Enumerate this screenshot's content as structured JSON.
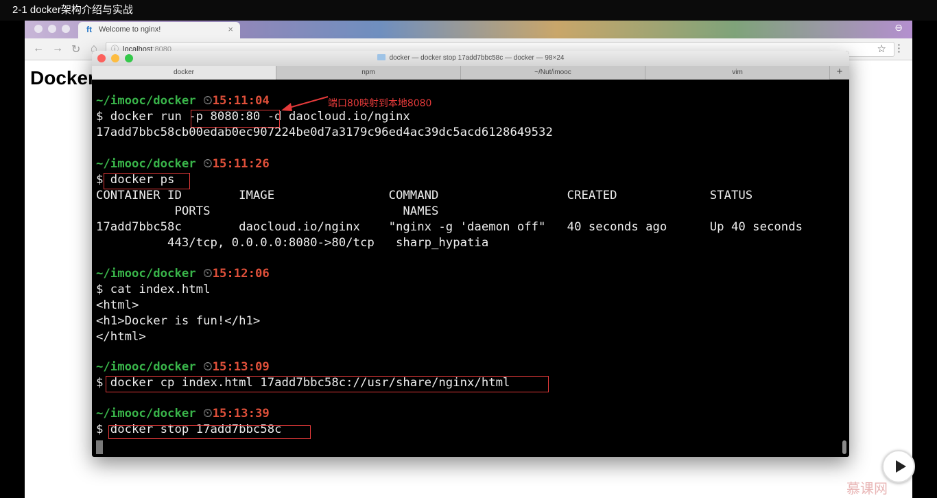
{
  "player": {
    "title": "2-1 docker架构介绍与实战"
  },
  "browser": {
    "tab_title": "Welcome to nginx!",
    "tab_favicon": "ft",
    "address_host": "localhost",
    "address_port": ":8080",
    "page_heading": "Docker"
  },
  "terminal": {
    "window_title": "docker — docker stop 17add7bbc58c — docker — 98×24",
    "tabs": [
      "docker",
      "npm",
      "~/Nut/imooc",
      "vim"
    ],
    "add_tab": "+",
    "lines": [
      {
        "path": "~/imooc/docker",
        "clock": "⏲",
        "time": "15:11:04"
      },
      {
        "text": "$ docker run -p 8080:80 -d daocloud.io/nginx"
      },
      {
        "text": "17add7bbc58cb00edab0ec907224be0d7a3179c96ed4ac39dc5acd6128649532"
      },
      {
        "path": "~/imooc/docker",
        "clock": "⏲",
        "time": "15:11:26"
      },
      {
        "text": "$ docker ps"
      },
      {
        "text": "CONTAINER ID        IMAGE                COMMAND                  CREATED             STATUS"
      },
      {
        "text": "           PORTS                           NAMES"
      },
      {
        "text": "17add7bbc58c        daocloud.io/nginx    \"nginx -g 'daemon off\"   40 seconds ago      Up 40 seconds"
      },
      {
        "text": "          443/tcp, 0.0.0.0:8080->80/tcp   sharp_hypatia"
      },
      {
        "path": "~/imooc/docker",
        "clock": "⏲",
        "time": "15:12:06"
      },
      {
        "text": "$ cat index.html"
      },
      {
        "text": "<html>"
      },
      {
        "text": "<h1>Docker is fun!</h1>"
      },
      {
        "text": "</html>"
      },
      {
        "path": "~/imooc/docker",
        "clock": "⏲",
        "time": "15:13:09"
      },
      {
        "text": "$ docker cp index.html 17add7bbc58c://usr/share/nginx/html"
      },
      {
        "path": "~/imooc/docker",
        "clock": "⏲",
        "time": "15:13:39"
      },
      {
        "text": "$ docker stop 17add7bbc58c"
      }
    ]
  },
  "annotation": {
    "text": "端口80映射到本地8080"
  },
  "watermark": "慕课网",
  "colors": {
    "prompt_path": "#39b54a",
    "prompt_time": "#e0503a",
    "highlight": "#e53a3a"
  }
}
